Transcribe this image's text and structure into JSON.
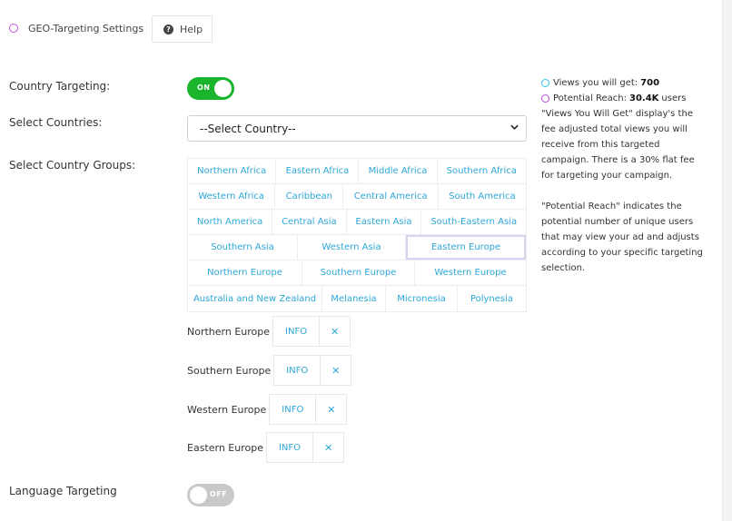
{
  "header": {
    "title": "GEO-Targeting Settings",
    "help_label": "Help"
  },
  "country_targeting": {
    "label": "Country Targeting:",
    "state": "ON"
  },
  "select_countries": {
    "label": "Select Countries:",
    "value": "--Select Country--"
  },
  "country_groups": {
    "label": "Select Country Groups:",
    "rows": [
      [
        "Northern Africa",
        "Eastern Africa",
        "Middle Africa",
        "Southern Africa"
      ],
      [
        "Western Africa",
        "Caribbean",
        "Central America",
        "South America"
      ],
      [
        "North America",
        "Central Asia",
        "Eastern Asia",
        "South-Eastern Asia"
      ],
      [
        "Southern Asia",
        "Western Asia",
        "Eastern Europe"
      ],
      [
        "Northern Europe",
        "Southern Europe",
        "Western Europe"
      ],
      [
        "Australia and New Zealand",
        "Melanesia",
        "Micronesia",
        "Polynesia"
      ]
    ],
    "highlighted": "Eastern Europe"
  },
  "selected_groups": [
    {
      "name": "Northern Europe",
      "info_label": "INFO"
    },
    {
      "name": "Southern Europe",
      "info_label": "INFO"
    },
    {
      "name": "Western Europe",
      "info_label": "INFO"
    },
    {
      "name": "Eastern Europe",
      "info_label": "INFO"
    }
  ],
  "language_targeting": {
    "label": "Language Targeting",
    "state": "OFF"
  },
  "stats": {
    "views_label": "Views you will get:",
    "views_value": "700",
    "reach_label": "Potential Reach:",
    "reach_value": "30.4K",
    "reach_suffix": "users"
  },
  "notes": {
    "views_note": "\"Views You Will Get\" display's the fee adjusted total views you will receive from this targeted campaign. There is a 30% flat fee for targeting your campaign.",
    "reach_note": "\"Potential Reach\" indicates the potential number of unique users that may view your ad and adjusts according to your specific targeting selection."
  },
  "colors": {
    "accent": "#2ea7d8",
    "toggle_on": "#1ab52c",
    "toggle_off": "#c9c9cb",
    "header_ring": "#c44fe0"
  }
}
